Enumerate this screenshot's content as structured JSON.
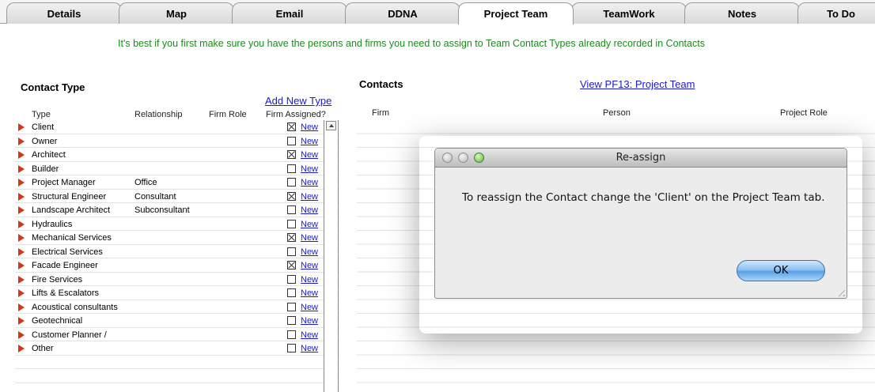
{
  "tabs": [
    {
      "label": "Details"
    },
    {
      "label": "Map"
    },
    {
      "label": "Email"
    },
    {
      "label": "DDNA"
    },
    {
      "label": "Project Team"
    },
    {
      "label": "TeamWork"
    },
    {
      "label": "Notes"
    },
    {
      "label": "To Do"
    }
  ],
  "hint": "It's best if you first make sure you have the persons and firms you need to assign to Team Contact Types already recorded in Contacts",
  "contact_type": {
    "heading": "Contact Type",
    "add_new_type": "Add New Type",
    "columns": {
      "type": "Type",
      "relationship": "Relationship",
      "firm_role": "Firm Role",
      "firm_assigned": "Firm Assigned?"
    },
    "new_label": "New",
    "rows": [
      {
        "type": "Client",
        "relationship": "",
        "assigned": true
      },
      {
        "type": "Owner",
        "relationship": "",
        "assigned": false
      },
      {
        "type": "Architect",
        "relationship": "",
        "assigned": true
      },
      {
        "type": "Builder",
        "relationship": "",
        "assigned": false
      },
      {
        "type": "Project Manager",
        "relationship": "Office",
        "assigned": false
      },
      {
        "type": "Structural Engineer",
        "relationship": "Consultant",
        "assigned": true
      },
      {
        "type": "Landscape Architect",
        "relationship": "Subconsultant",
        "assigned": false
      },
      {
        "type": "Hydraulics",
        "relationship": "",
        "assigned": false
      },
      {
        "type": "Mechanical Services",
        "relationship": "",
        "assigned": true
      },
      {
        "type": "Electrical Services",
        "relationship": "",
        "assigned": false
      },
      {
        "type": "Facade Engineer",
        "relationship": "",
        "assigned": true
      },
      {
        "type": "Fire Services",
        "relationship": "",
        "assigned": false
      },
      {
        "type": "Lifts & Escalators",
        "relationship": "",
        "assigned": false
      },
      {
        "type": "Acoustical consultants",
        "relationship": "",
        "assigned": false
      },
      {
        "type": "Geotechnical",
        "relationship": "",
        "assigned": false
      },
      {
        "type": "Customer Planner /",
        "relationship": "",
        "assigned": false
      },
      {
        "type": "Other",
        "relationship": "",
        "assigned": false
      }
    ]
  },
  "contacts": {
    "heading": "Contacts",
    "view_link": "View PF13: Project Team",
    "columns": {
      "firm": "Firm",
      "person": "Person",
      "project_role": "Project Role"
    }
  },
  "dialog": {
    "title": "Re-assign",
    "message": "To reassign the Contact change the 'Client' on the Project Team tab.",
    "ok_label": "OK"
  },
  "colors": {
    "accent_green": "#1c8a1c",
    "link_blue": "#1a1ad0",
    "arrow_red": "#d6361a"
  }
}
